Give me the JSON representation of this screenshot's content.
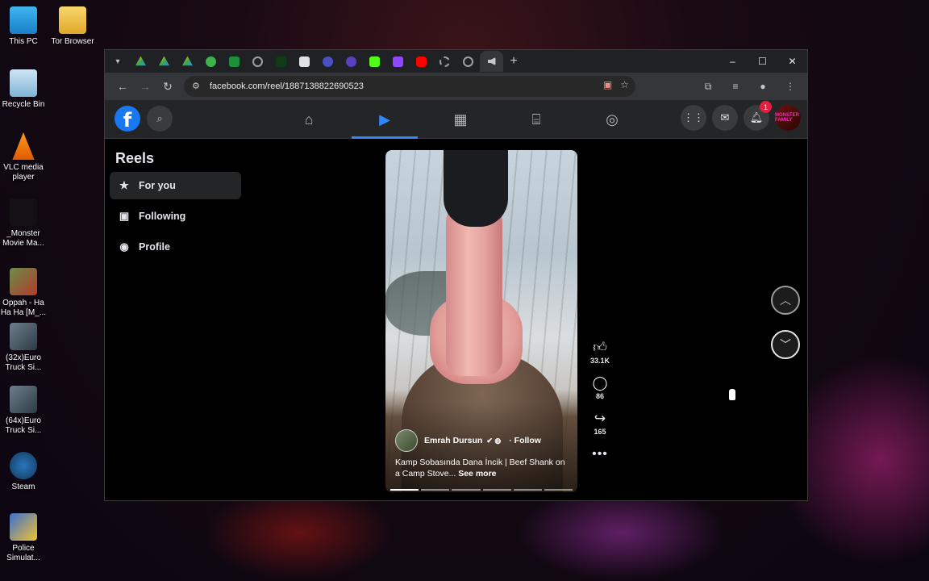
{
  "desktop": {
    "icons": [
      {
        "label": "This PC"
      },
      {
        "label": "Tor Browser"
      },
      {
        "label": "Recycle Bin"
      },
      {
        "label": "VLC media player"
      },
      {
        "label": "_Monster Movie Ma..."
      },
      {
        "label": "Oppah - Ha Ha Ha [M_..."
      },
      {
        "label": "(32x)Euro Truck Si..."
      },
      {
        "label": "(64x)Euro Truck Si..."
      },
      {
        "label": "Steam"
      },
      {
        "label": "Police Simulat..."
      }
    ]
  },
  "browser": {
    "url": "facebook.com/reel/1887138822690523",
    "window_controls": {
      "minimize": "–",
      "maximize": "☐",
      "close": "✕"
    },
    "new_tab": "+"
  },
  "facebook": {
    "logo_letter": "f",
    "notification_count": "1",
    "avatar_text": "MONSTER FAMILY",
    "reels": {
      "title": "Reels",
      "nav": [
        {
          "label": "For you"
        },
        {
          "label": "Following"
        },
        {
          "label": "Profile"
        }
      ]
    },
    "video": {
      "author": "Emrah Dursun",
      "follow_label": "· Follow",
      "caption": "Kamp Sobasında Dana İncik | Beef Shank on a Camp Stove...",
      "see_more": "See more"
    },
    "actions": {
      "likes": "33.1K",
      "comments": "86",
      "shares": "165"
    }
  }
}
